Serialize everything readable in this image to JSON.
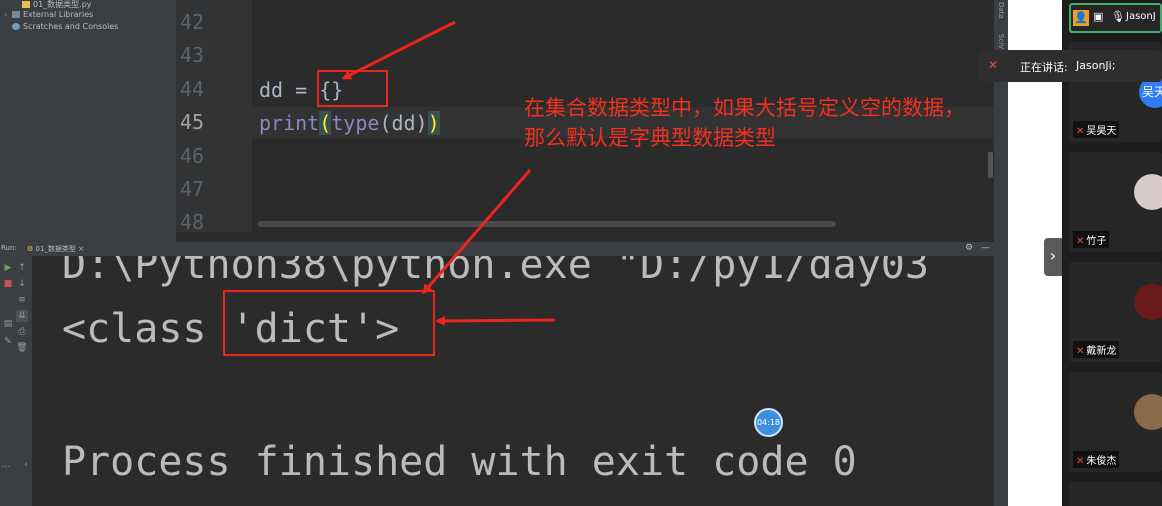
{
  "project_tree": {
    "items": [
      {
        "label": "01_数据类型.py"
      },
      {
        "label": "External Libraries"
      },
      {
        "label": "Scratches and Consoles"
      }
    ]
  },
  "editor": {
    "line_numbers": [
      "42",
      "43",
      "44",
      "45",
      "46",
      "47",
      "48"
    ],
    "current_line": "45",
    "code": {
      "line44": {
        "var": "dd = ",
        "value": "{}"
      },
      "line45": {
        "fn1": "print",
        "open1": "(",
        "fn2": "type",
        "arg": "(dd)",
        "close1": ")"
      }
    }
  },
  "run_panel": {
    "tab_label": "Run:",
    "config_label": "01_数据类型",
    "console_lines": [
      "D:\\Python38\\python.exe \"D:/py1/day03",
      "<class 'dict'>",
      "Process finished with exit code 0"
    ]
  },
  "annotation": {
    "text": "在集合数据类型中，如果大括号定义空的数据，那么默认是字典型数据类型",
    "color": "#f03020"
  },
  "side_strip": {
    "labels": [
      "Data",
      "SciV"
    ]
  },
  "meeting": {
    "speaking_prefix": "正在讲话:",
    "speaking_name": "JasonJi;",
    "top_tile_name": "JasonJ",
    "partial_tile_label": "吴天",
    "participants": [
      {
        "name": "吴昊天"
      },
      {
        "name": "竹子"
      },
      {
        "name": "戴新龙"
      },
      {
        "name": "朱俊杰"
      }
    ]
  },
  "time_badge": "04:18"
}
